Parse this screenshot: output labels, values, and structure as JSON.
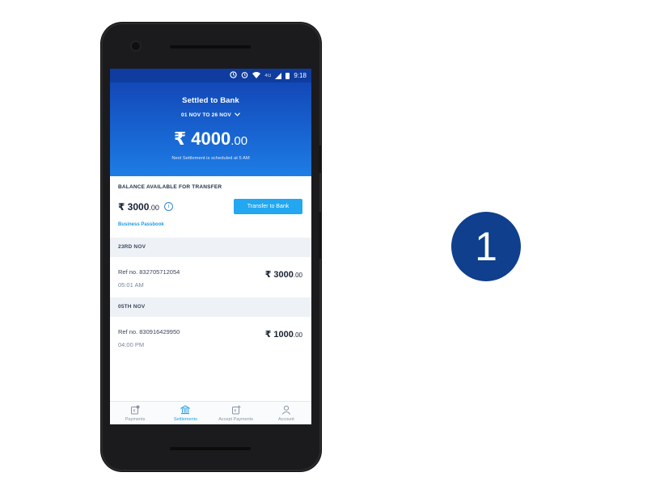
{
  "status_bar": {
    "time": "9:18",
    "network": "4G",
    "icons": [
      "sync-icon",
      "alarm-icon",
      "wifi-icon",
      "signal-icon",
      "battery-icon"
    ]
  },
  "header": {
    "title": "Settled to Bank",
    "date_range": "01 NOV TO 26 NOV",
    "amount_main": "₹ 4000",
    "amount_decimal": ".00",
    "note": "Next Settlement is scheduled at 5 AM"
  },
  "balance": {
    "title": "BALANCE AVAILABLE FOR TRANSFER",
    "amount_main": "₹ 3000",
    "amount_decimal": ".00",
    "transfer_button": "Transfer to Bank",
    "passbook_link": "Business Passbook"
  },
  "settlements": [
    {
      "date": "23RD NOV",
      "ref": "Ref no. 832705712054",
      "time": "05:01 AM",
      "amount_main": "₹ 3000",
      "amount_decimal": ".00"
    },
    {
      "date": "05TH NOV",
      "ref": "Ref no. 830916429950",
      "time": "04:00 PM",
      "amount_main": "₹ 1000",
      "amount_decimal": ".00"
    }
  ],
  "bottom_nav": [
    {
      "label": "Payments",
      "icon": "payments-icon",
      "active": false
    },
    {
      "label": "Settlements",
      "icon": "bank-icon",
      "active": true
    },
    {
      "label": "Accept Payments",
      "icon": "accept-payments-icon",
      "active": false
    },
    {
      "label": "Account",
      "icon": "person-icon",
      "active": false
    }
  ],
  "step_badge": "1",
  "colors": {
    "header_blue": "#1867d4",
    "accent": "#22a7f0",
    "badge": "#0f3f8d"
  }
}
